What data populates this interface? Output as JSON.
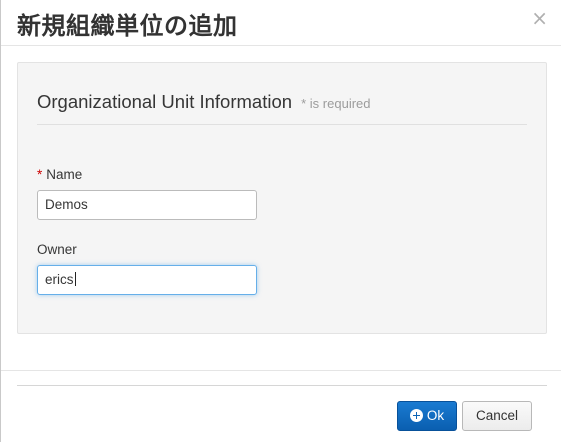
{
  "dialog": {
    "title": "新規組織単位の追加",
    "close_glyph": "×"
  },
  "section": {
    "title": "Organizational Unit Information",
    "required_note": "* is required"
  },
  "form": {
    "name": {
      "required_marker": "*",
      "label": "Name",
      "value": "Demos"
    },
    "owner": {
      "label": "Owner",
      "value": "erics"
    }
  },
  "footer": {
    "ok_label": "Ok",
    "ok_icon": "plus-circle-icon",
    "cancel_label": "Cancel"
  },
  "colors": {
    "primary": "#0d64b6",
    "required": "#cc0000",
    "focus": "#66afe9"
  }
}
